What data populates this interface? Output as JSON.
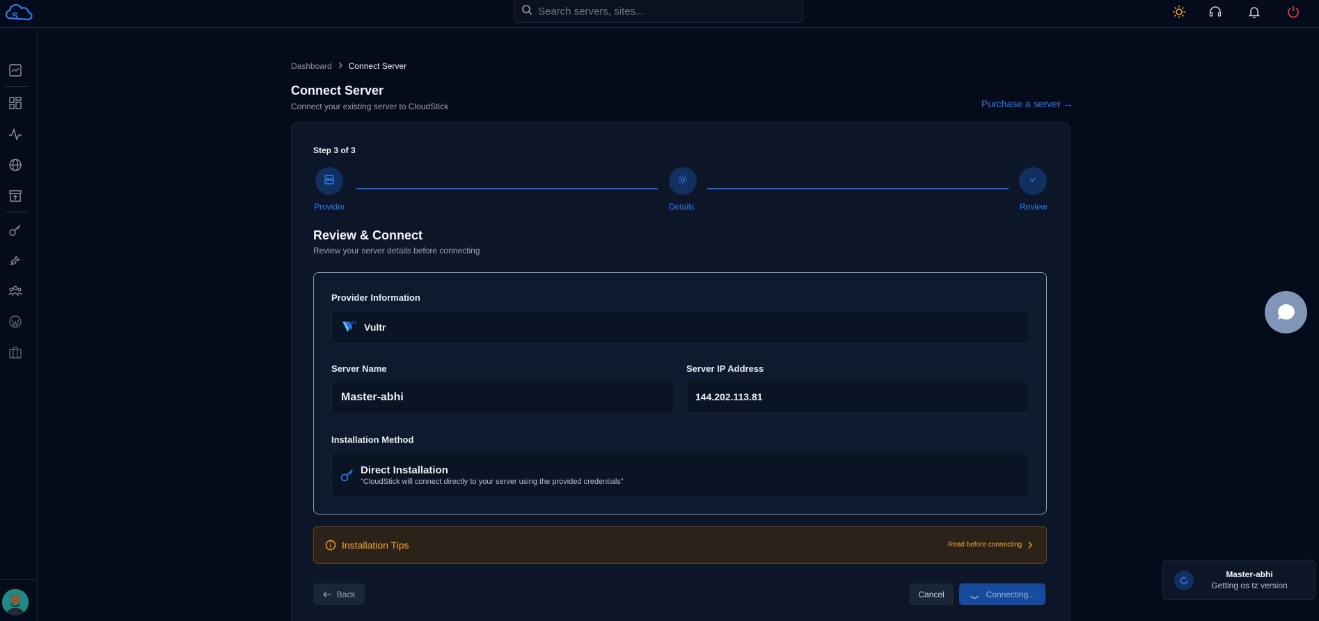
{
  "app": {
    "logo_icon": "cloudstick-logo",
    "accent": "#2f7bf0",
    "warning": "#f5a623",
    "danger": "#e5383b"
  },
  "search": {
    "placeholder": "Search servers, sites..."
  },
  "topbar": {
    "icons": [
      "sun-icon",
      "headset-icon",
      "bell-icon",
      "power-icon"
    ]
  },
  "sidebar": {
    "icons": [
      "server-stats-icon",
      "dashboard-grid-icon",
      "activity-icon",
      "globe-icon",
      "store-upload-icon",
      "key-icon",
      "plug-icon",
      "team-icon",
      "wordpress-icon",
      "briefcase-icon"
    ]
  },
  "breadcrumb": {
    "items": [
      "Dashboard",
      "Connect Server"
    ]
  },
  "page": {
    "title": "Connect Server",
    "subtitle": "Connect your existing server to CloudStick",
    "purchase_link": "Purchase a server →"
  },
  "stepper": {
    "step_text": "Step 3 of 3",
    "steps": [
      {
        "label": "Provider",
        "icon": "server-icon"
      },
      {
        "label": "Details",
        "icon": "gear-icon"
      },
      {
        "label": "Review",
        "icon": "check-icon"
      }
    ]
  },
  "review": {
    "title": "Review & Connect",
    "subtitle": "Review your server details before connecting",
    "provider_label": "Provider Information",
    "provider_name": "Vultr",
    "server_name_label": "Server Name",
    "server_name": "Master-abhi",
    "server_ip_label": "Server IP Address",
    "server_ip": "144.202.113.81",
    "install_method_label": "Installation Method",
    "install_method_title": "Direct Installation",
    "install_method_desc": "\"CloudStick will connect directly to your server using the provided credentials\""
  },
  "tips": {
    "title": "Installation Tips",
    "link": "Read before connecting"
  },
  "actions": {
    "back": "Back",
    "cancel": "Cancel",
    "connect": "Connecting..."
  },
  "toast": {
    "title": "Master-abhi",
    "message": "Getting os tz version"
  }
}
